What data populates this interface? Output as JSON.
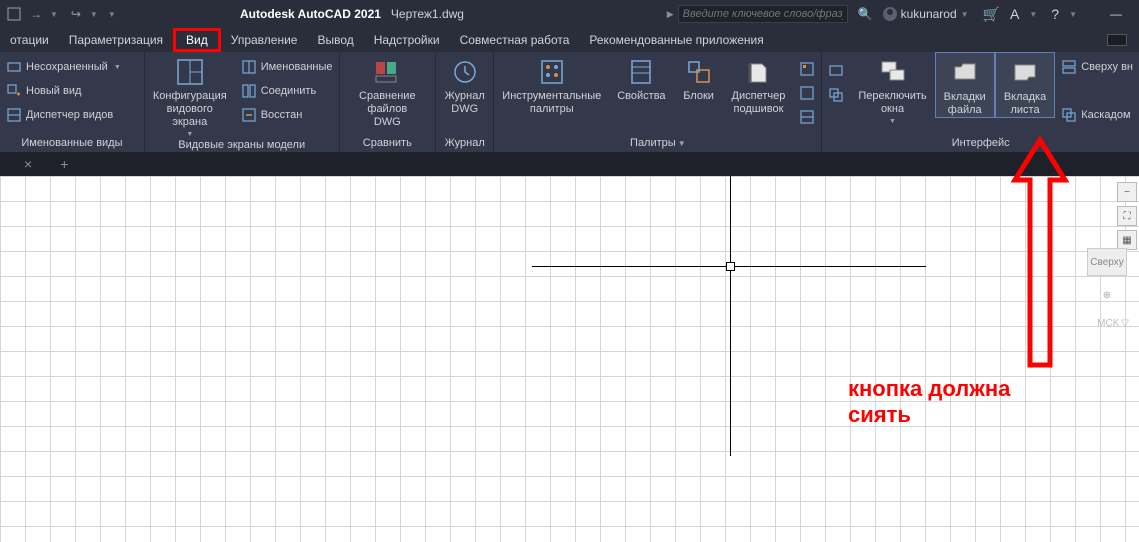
{
  "title": {
    "app": "Autodesk AutoCAD 2021",
    "doc": "Чертеж1.dwg"
  },
  "search": {
    "placeholder": "Введите ключевое слово/фразу"
  },
  "user": {
    "name": "kukunarod"
  },
  "menu": {
    "items": [
      "отации",
      "Параметризация",
      "Вид",
      "Управление",
      "Вывод",
      "Надстройки",
      "Совместная работа",
      "Рекомендованные приложения"
    ],
    "highlighted": "Вид"
  },
  "ribbon": {
    "panels": [
      {
        "label": "Именованные виды",
        "rows": [
          "Несохраненный",
          "Новый вид",
          "Диспетчер видов"
        ]
      },
      {
        "label": "Видовые экраны модели",
        "big": {
          "line1": "Конфигурация",
          "line2": "видового экрана"
        },
        "rows": [
          "Именованные",
          "Соединить",
          "Восстан"
        ]
      },
      {
        "label": "Сравнить",
        "big": {
          "line1": "Сравнение файлов",
          "line2": "DWG"
        }
      },
      {
        "label": "Журнал",
        "big": {
          "line1": "Журнал",
          "line2": "DWG"
        }
      },
      {
        "label": "Палитры",
        "bigs": [
          {
            "line1": "Инструментальные",
            "line2": "палитры"
          },
          {
            "line1": "Свойства",
            "line2": ""
          },
          {
            "line1": "Блоки",
            "line2": ""
          },
          {
            "line1": "Диспетчер",
            "line2": "подшивок"
          }
        ]
      },
      {
        "label": "Интерфейс",
        "bigs": [
          {
            "line1": "Переключить",
            "line2": "окна"
          },
          {
            "line1": "Вкладки",
            "line2": "файла"
          },
          {
            "line1": "Вкладка",
            "line2": "листа"
          }
        ],
        "rows": [
          "Сверху вн",
          "Каскадом"
        ]
      }
    ]
  },
  "viewcube": "Сверху",
  "mck": "МСК",
  "annotation": {
    "line1": "кнопка должна",
    "line2": "сиять"
  }
}
